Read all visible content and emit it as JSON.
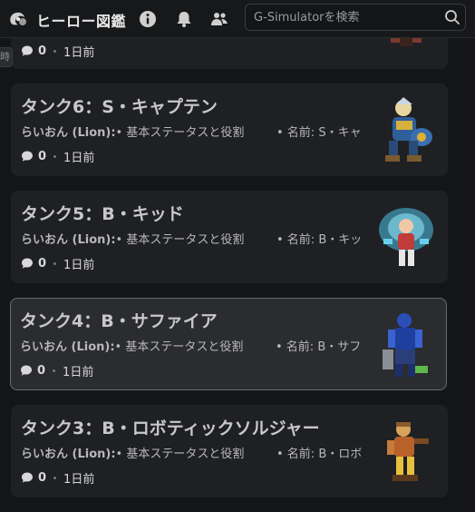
{
  "header": {
    "site_title": "ヒーロー図鑑",
    "search_placeholder": "G-Simulatorを検索"
  },
  "side_tab": {
    "label": "時"
  },
  "cards": [
    {
      "title": "",
      "author": "",
      "summary": "",
      "meta": "",
      "comments": "0",
      "time": "1日前",
      "image": "hero-sprite-dark"
    },
    {
      "title": "タンク6：S・キャプテン",
      "author": "らいおん (Lion):",
      "summary": "• 基本ステータスと役割",
      "meta": "• 名前: S・キャ",
      "comments": "0",
      "time": "1日前",
      "image": "hero-sprite-captain"
    },
    {
      "title": "タンク5：B・キッド",
      "author": "らいおん (Lion):",
      "summary": "• 基本ステータスと役割",
      "meta": "• 名前: B・キッ",
      "comments": "0",
      "time": "1日前",
      "image": "hero-sprite-kid"
    },
    {
      "title": "タンク4：B・サファイア",
      "author": "らいおん (Lion):",
      "summary": "• 基本ステータスと役割",
      "meta": "• 名前: B・サフ",
      "comments": "0",
      "time": "1日前",
      "image": "hero-sprite-sapphire"
    },
    {
      "title": "タンク3：B・ロボティックソルジャー",
      "author": "らいおん (Lion):",
      "summary": "• 基本ステータスと役割",
      "meta": "• 名前: B・ロボ",
      "comments": "0",
      "time": "1日前",
      "image": "hero-sprite-robotic-soldier"
    }
  ],
  "colors": {
    "background": "#141517",
    "card": "#1f2023",
    "card_active": "#2b2c2f",
    "text": "#c8c8c8"
  }
}
